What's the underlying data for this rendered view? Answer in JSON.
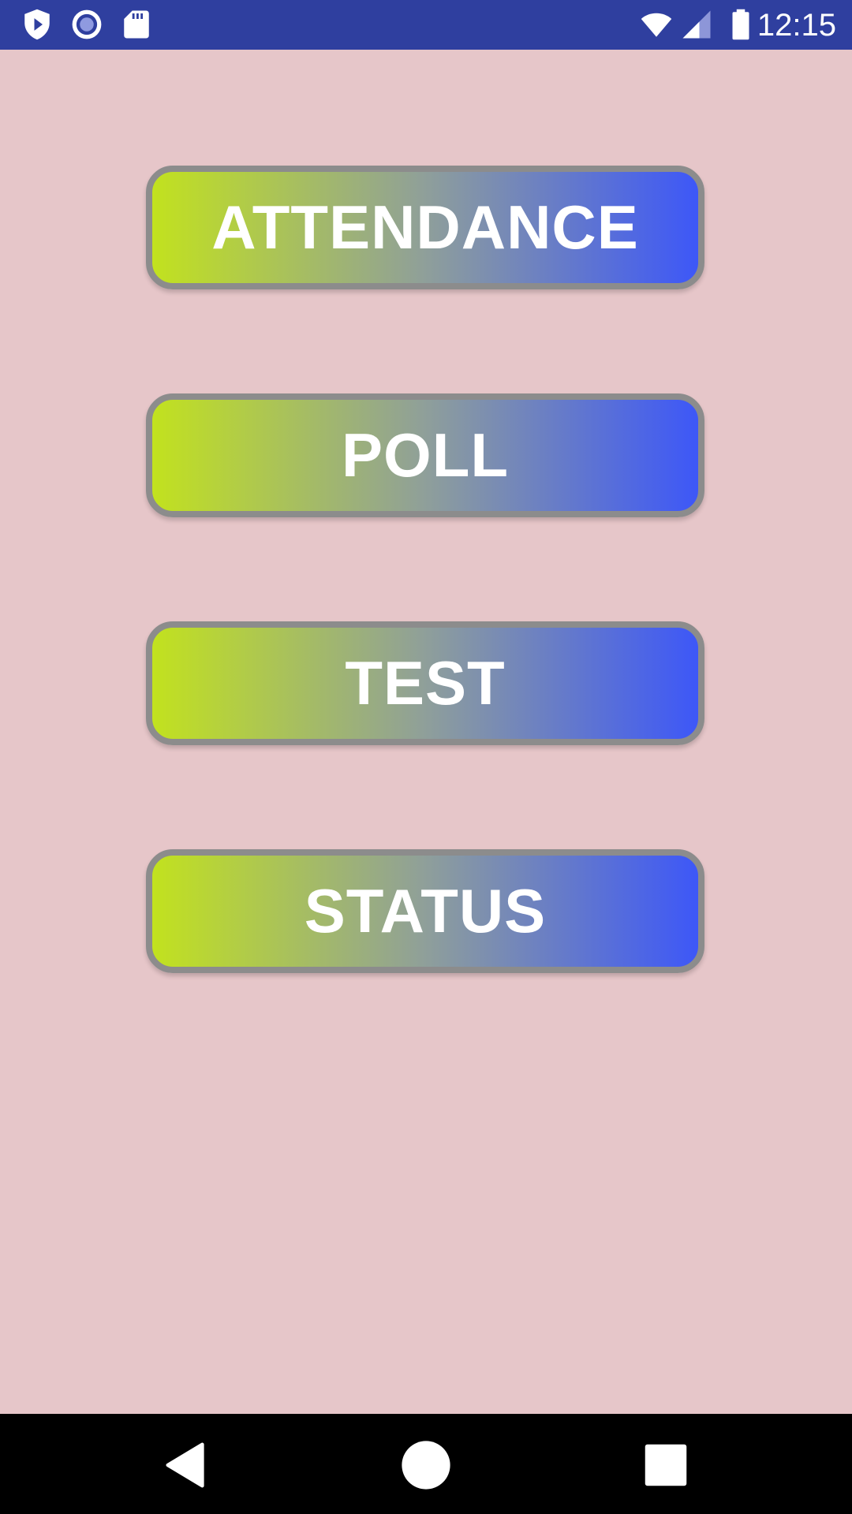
{
  "status_bar": {
    "time": "12:15",
    "left_icons": [
      "play-protect-icon",
      "record-icon",
      "sd-card-icon"
    ],
    "right_icons": [
      "wifi-icon",
      "cell-signal-icon",
      "battery-icon"
    ],
    "background_color": "#2f3f9f"
  },
  "menu": {
    "buttons": [
      {
        "label": "ATTENDANCE"
      },
      {
        "label": "POLL"
      },
      {
        "label": "TEST"
      },
      {
        "label": "STATUS"
      }
    ],
    "gradient_colors": [
      "#c2e21e",
      "#8f9f9a",
      "#3d57f8"
    ],
    "border_color": "#8c8c8c"
  },
  "page": {
    "background_color": "#e6c6c9"
  },
  "nav_bar": {
    "buttons": [
      "back-icon",
      "home-icon",
      "recents-icon"
    ]
  }
}
